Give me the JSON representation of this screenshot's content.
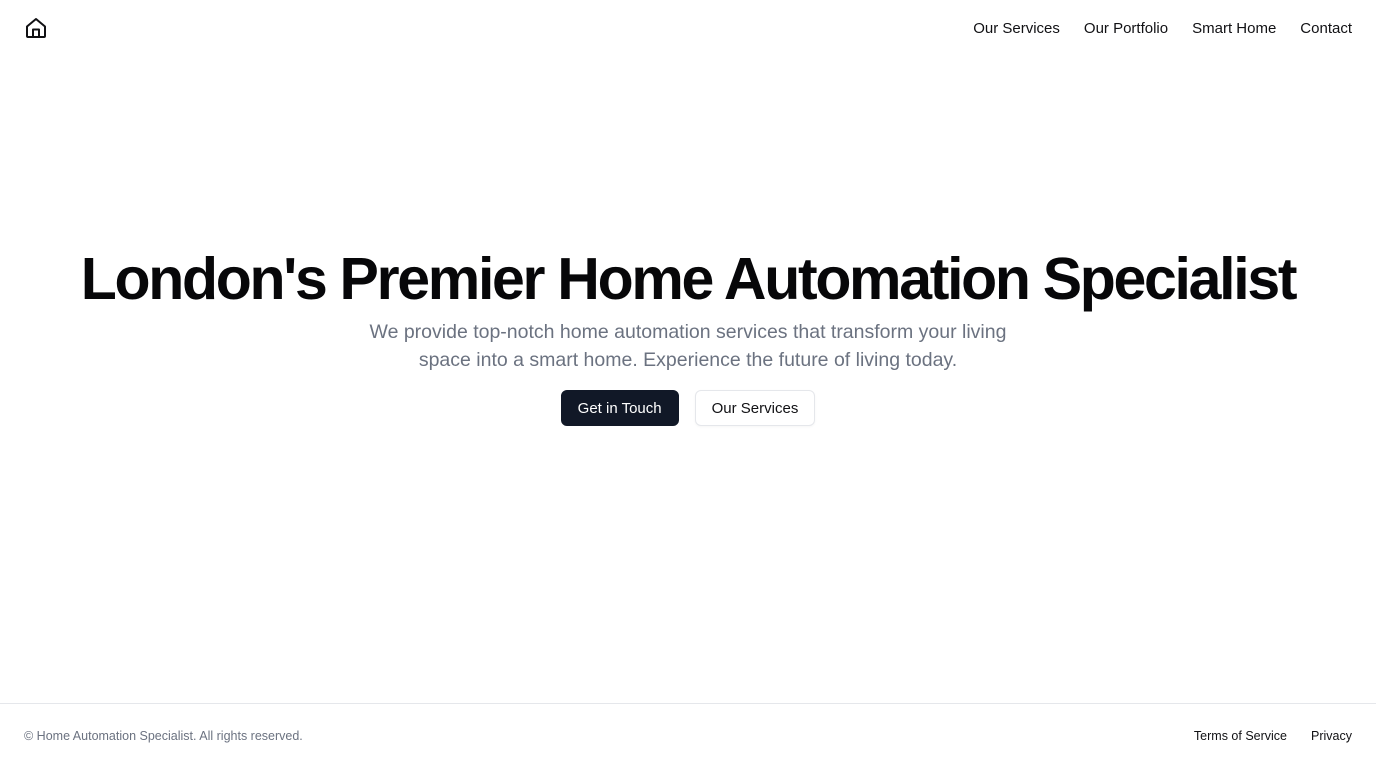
{
  "header": {
    "logo_icon": "home-icon",
    "nav": [
      {
        "label": "Our Services"
      },
      {
        "label": "Our Portfolio"
      },
      {
        "label": "Smart Home"
      },
      {
        "label": "Contact"
      }
    ]
  },
  "hero": {
    "title": "London's Premier Home Automation Specialist",
    "subtitle": "We provide top-notch home automation services that transform your living space into a smart home. Experience the future of living today.",
    "primary_button": "Get in Touch",
    "secondary_button": "Our Services"
  },
  "footer": {
    "copyright": "© Home Automation Specialist. All rights reserved.",
    "links": [
      {
        "label": "Terms of Service"
      },
      {
        "label": "Privacy"
      }
    ]
  },
  "colors": {
    "primary_button_bg": "#111827",
    "subtitle_text": "#6b7280",
    "border": "#e5e7eb"
  }
}
